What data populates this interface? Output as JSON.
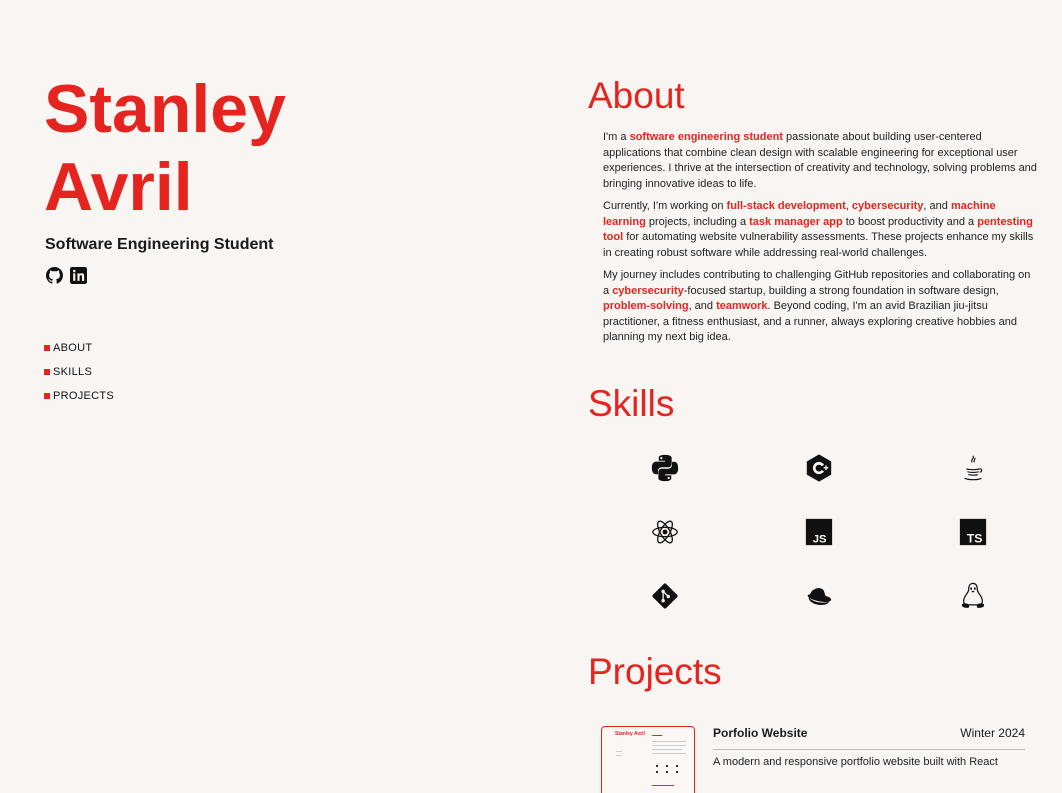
{
  "profile": {
    "first_name": "Stanley",
    "last_name": "Avril",
    "subtitle": "Software Engineering Student"
  },
  "socials": [
    {
      "icon": "github-icon",
      "label": "GitHub"
    },
    {
      "icon": "linkedin-icon",
      "label": "LinkedIn"
    }
  ],
  "nav": {
    "about": "ABOUT",
    "skills": "SKILLS",
    "projects": "PROJECTS"
  },
  "about": {
    "title": "About",
    "p1": {
      "a": "I'm a ",
      "b": "software engineering student",
      "c": " passionate about building user-centered applications that combine clean design with scalable engineering for exceptional user experiences. I thrive at the intersection of creativity and technology, solving problems and bringing innovative ideas to life."
    },
    "p2": {
      "a": "Currently, I'm working on ",
      "b": "full-stack development",
      "c": ", ",
      "d": "cybersecurity",
      "e": ", and ",
      "f": "machine learning",
      "g": " projects, including a ",
      "h": "task manager app",
      "i": " to boost productivity and a ",
      "j": "pentesting tool",
      "k": " for automating website vulnerability assessments. These projects enhance my skills in creating robust software while addressing real-world challenges."
    },
    "p3": {
      "a": "My journey includes contributing to challenging GitHub repositories and collaborating on a ",
      "b": "cybersecurity",
      "c": "-focused startup, building a strong foundation in software design, ",
      "d": "problem-solving",
      "e": ", and ",
      "f": "teamwork",
      "g": ". Beyond coding, I'm an avid Brazilian jiu-jitsu practitioner, a fitness enthusiast, and a runner, always exploring creative hobbies and planning my next big idea."
    }
  },
  "skills": {
    "title": "Skills",
    "icons": [
      "python-icon",
      "c-plus-plus-icon",
      "java-icon",
      "react-icon",
      "javascript-icon",
      "typescript-icon",
      "git-icon",
      "red-hat-icon",
      "linux-tux-icon"
    ],
    "js_text": "JS",
    "ts_text": "TS"
  },
  "projects": {
    "title": "Projects",
    "items": [
      {
        "title": "Porfolio Website",
        "date": "Winter 2024",
        "description": "A modern and responsive portfolio website built with React"
      }
    ],
    "thumb_name": "Stanley Avril"
  },
  "colors": {
    "accent": "#e52420",
    "background": "#f9f5f2",
    "text": "#1a1a1a"
  }
}
